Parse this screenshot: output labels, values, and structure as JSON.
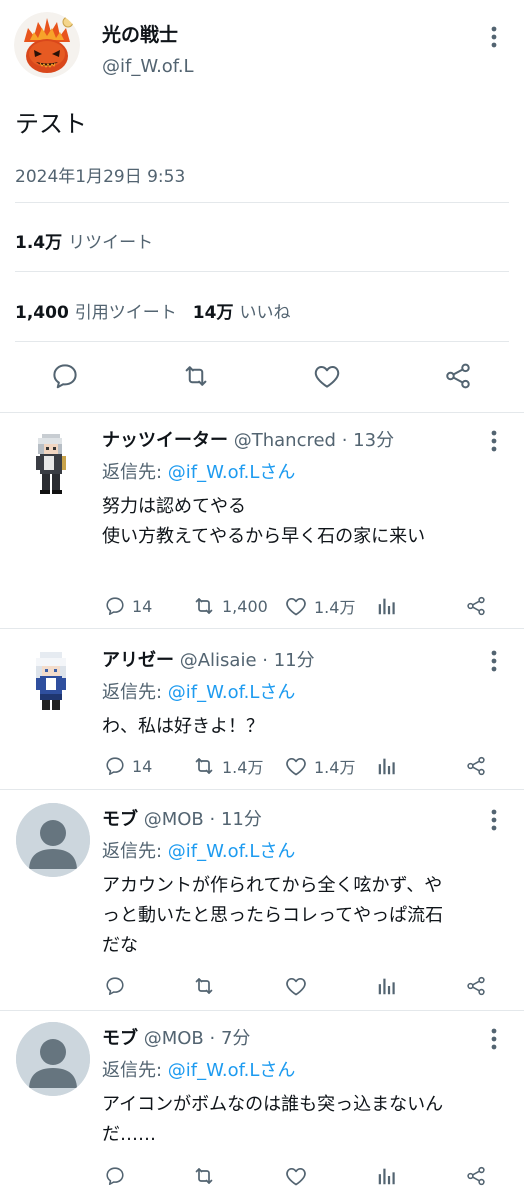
{
  "main_tweet": {
    "display_name": "光の戦士",
    "handle": "@if_W.of.L",
    "text": "テスト",
    "timestamp": "2024年1月29日 9:53",
    "retweets": {
      "count": "1.4万",
      "label": "リツイート"
    },
    "quotes": {
      "count": "1,400",
      "label": "引用ツイート"
    },
    "likes": {
      "count": "14万",
      "label": "いいね"
    },
    "avatar_icon": "bomb-icon"
  },
  "replies": [
    {
      "display_name": "ナッツイーター",
      "handle": "@Thancred",
      "time": "· 13分",
      "reply_prefix": "返信先: ",
      "reply_target": "@if_W.of.Lさん",
      "lines": [
        "努力は認めてやる",
        "使い方教えてやるから早く石の家に来い"
      ],
      "reply_count": "14",
      "retweet_count": "1,400",
      "like_count": "1.4万",
      "avatar_icon": "pixel-character-icon"
    },
    {
      "display_name": "アリゼー",
      "handle": "@Alisaie",
      "time": "· 11分",
      "reply_prefix": "返信先: ",
      "reply_target": "@if_W.of.Lさん",
      "lines": [
        "わ、私は好きよ！？"
      ],
      "reply_count": "14",
      "retweet_count": "1.4万",
      "like_count": "1.4万",
      "avatar_icon": "pixel-character-icon"
    },
    {
      "display_name": "モブ",
      "handle": "@MOB",
      "time": "· 11分",
      "reply_prefix": "返信先: ",
      "reply_target": "@if_W.of.Lさん",
      "lines": [
        "アカウントが作られてから全く呟かず、や",
        "っと動いたと思ったらコレってやっぱ流石",
        "だな"
      ],
      "reply_count": "",
      "retweet_count": "",
      "like_count": "",
      "avatar_icon": "default-avatar-icon"
    },
    {
      "display_name": "モブ",
      "handle": "@MOB",
      "time": "· 7分",
      "reply_prefix": "返信先: ",
      "reply_target": "@if_W.of.Lさん",
      "lines": [
        "アイコンがボムなのは誰も突っ込まないん",
        "だ……"
      ],
      "reply_count": "",
      "retweet_count": "",
      "like_count": "",
      "avatar_icon": "default-avatar-icon"
    }
  ],
  "colors": {
    "text": "#0f1419",
    "secondary": "#536471",
    "link": "#1d9bf0",
    "divider": "#e4e8eb"
  }
}
